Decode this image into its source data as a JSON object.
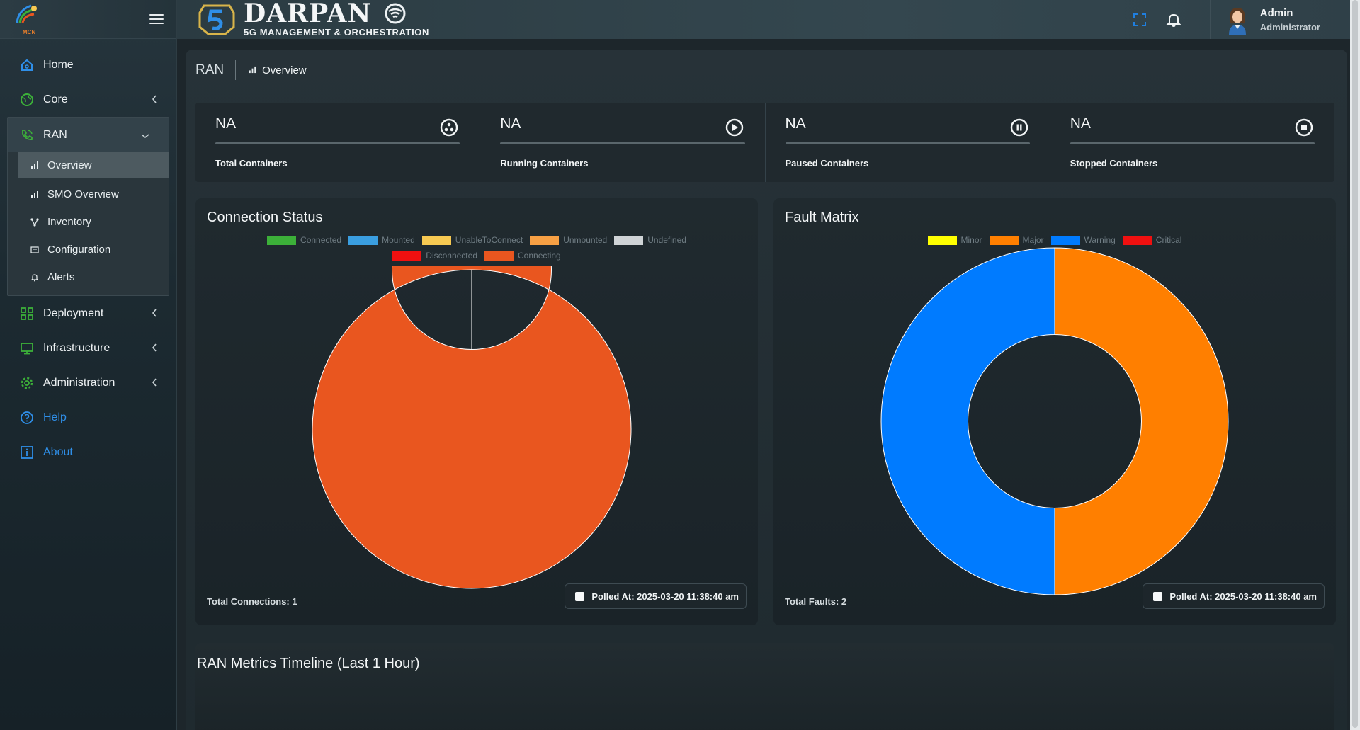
{
  "brand": {
    "logo_text": "MCN",
    "title": "DARPAN",
    "subtitle": "5G MANAGEMENT & ORCHESTRATION"
  },
  "header": {
    "user_name": "Admin",
    "user_role": "Administrator"
  },
  "sidebar": {
    "items": [
      {
        "label": "Home"
      },
      {
        "label": "Core"
      },
      {
        "label": "RAN"
      },
      {
        "label": "Deployment"
      },
      {
        "label": "Infrastructure"
      },
      {
        "label": "Administration"
      },
      {
        "label": "Help"
      },
      {
        "label": "About"
      }
    ],
    "ran_sub": [
      {
        "label": "Overview"
      },
      {
        "label": "SMO Overview"
      },
      {
        "label": "Inventory"
      },
      {
        "label": "Configuration"
      },
      {
        "label": "Alerts"
      }
    ]
  },
  "breadcrumb": {
    "root": "RAN",
    "current": "Overview"
  },
  "stats": [
    {
      "value": "NA",
      "label": "Total Containers"
    },
    {
      "value": "NA",
      "label": "Running Containers"
    },
    {
      "value": "NA",
      "label": "Paused Containers"
    },
    {
      "value": "NA",
      "label": "Stopped Containers"
    }
  ],
  "connection_status": {
    "title": "Connection Status",
    "footer": "Total Connections: 1",
    "polled": "Polled At: 2025-03-20 11:38:40 am"
  },
  "fault_matrix": {
    "title": "Fault Matrix",
    "footer": "Total Faults: 2",
    "polled": "Polled At: 2025-03-20 11:38:40 am"
  },
  "timeline": {
    "title": "RAN Metrics Timeline (Last 1 Hour)"
  },
  "colors": {
    "accent_blue": "#2f8fe8",
    "connecting": "#e9561f",
    "major": "#ff7f00",
    "warning": "#007bff"
  },
  "chart_data": [
    {
      "type": "pie",
      "title": "Connection Status",
      "categories": [
        "Connected",
        "Mounted",
        "UnableToConnect",
        "Unmounted",
        "Undefined",
        "Disconnected",
        "Connecting"
      ],
      "values": [
        0,
        0,
        0,
        0,
        0,
        0,
        1
      ],
      "colors": [
        "#3cb039",
        "#3a9ee0",
        "#f7c952",
        "#f7a044",
        "#cfd3d6",
        "#f01010",
        "#e9561f"
      ],
      "legend": "top"
    },
    {
      "type": "pie",
      "title": "Fault Matrix",
      "categories": [
        "Minor",
        "Major",
        "Warning",
        "Critical"
      ],
      "values": [
        0,
        1,
        1,
        0
      ],
      "colors": [
        "#ffff00",
        "#ff7f00",
        "#007bff",
        "#f01010"
      ],
      "legend": "top"
    }
  ]
}
